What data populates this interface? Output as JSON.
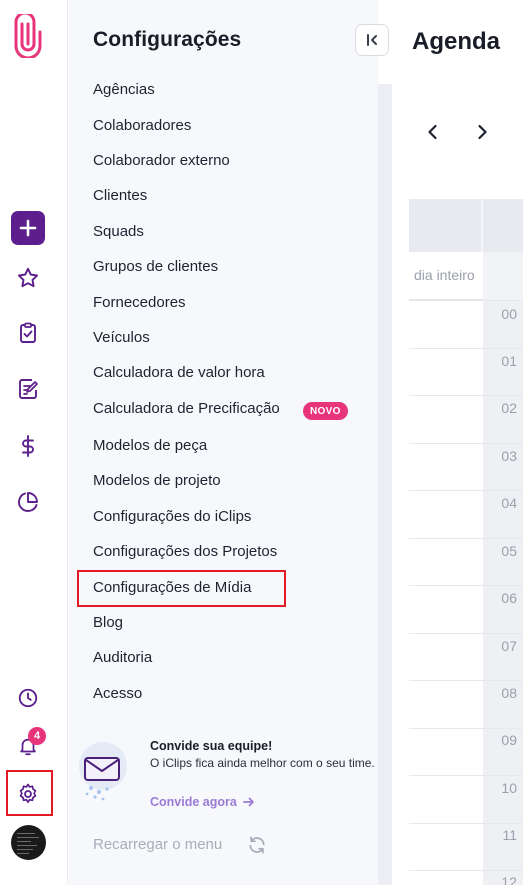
{
  "rail": {
    "notification_count": "4"
  },
  "panel": {
    "title": "Configurações",
    "items": [
      "Agências",
      "Colaboradores",
      "Colaborador externo",
      "Clientes",
      "Squads",
      "Grupos de clientes",
      "Fornecedores",
      "Veículos",
      "Calculadora de valor hora",
      "Calculadora de Precificação",
      "Modelos de peça",
      "Modelos de projeto",
      "Configurações do iClips",
      "Configurações dos Projetos",
      "Configurações de Mídia",
      "Blog",
      "Auditoria",
      "Acesso"
    ],
    "new_badge": "NOVO",
    "invite": {
      "title": "Convide sua equipe!",
      "description": "O iClips fica ainda melhor com o seu time.",
      "link": "Convide agora"
    },
    "reload": "Recarregar o menu"
  },
  "agenda": {
    "title": "Agenda",
    "all_day": "dia inteiro",
    "hours": [
      "00",
      "01",
      "02",
      "03",
      "04",
      "05",
      "06",
      "07",
      "08",
      "09",
      "10",
      "11",
      "12"
    ]
  },
  "colors": {
    "brand": "#5d1f8c",
    "logo_pink": "#e8347a",
    "badge": "#e8347a",
    "highlight": "#e01b24"
  }
}
